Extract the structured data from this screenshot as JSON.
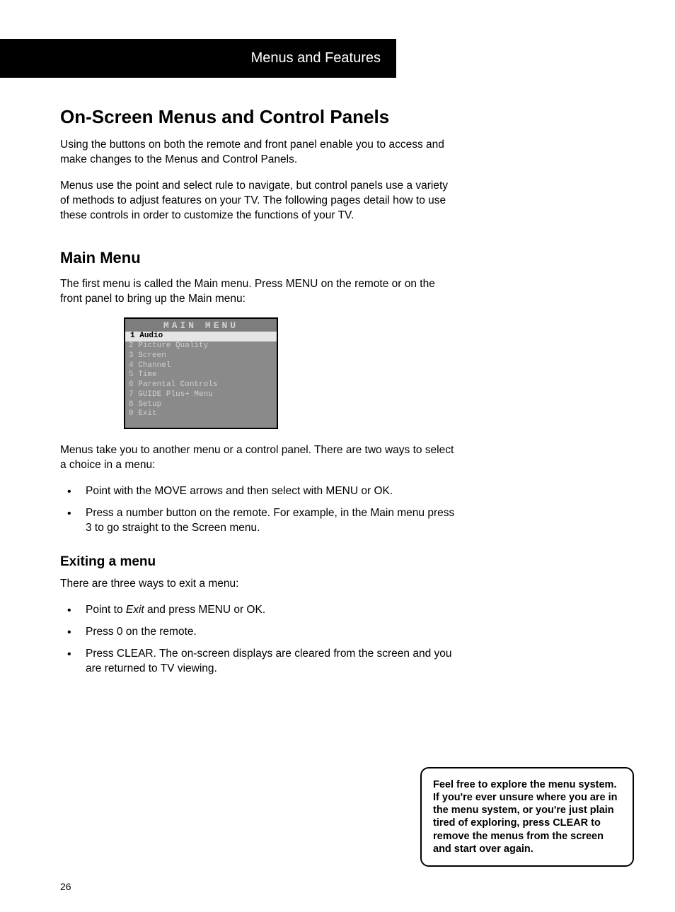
{
  "chapter_bar": "Menus and Features",
  "section1": {
    "title": "On-Screen Menus and Control Panels",
    "p1": "Using the buttons on both the remote and front panel enable you to access and make changes to the Menus and Control Panels.",
    "p2": "Menus use the point and select rule to navigate, but control panels use a variety of methods to adjust features on your TV. The following pages detail how to use these controls in order to customize the functions of your TV."
  },
  "section2": {
    "title": "Main Menu",
    "p1": "The first menu is called the Main menu. Press MENU on the remote or on the front panel to bring up the Main menu:",
    "osd_title": "MAIN MENU",
    "osd_items": [
      {
        "num": "1",
        "label": "Audio"
      },
      {
        "num": "2",
        "label": "Picture Quality"
      },
      {
        "num": "3",
        "label": "Screen"
      },
      {
        "num": "4",
        "label": "Channel"
      },
      {
        "num": "5",
        "label": "Time"
      },
      {
        "num": "6",
        "label": "Parental Controls"
      },
      {
        "num": "7",
        "label": "GUIDE Plus+ Menu"
      },
      {
        "num": "8",
        "label": "Setup"
      },
      {
        "num": "0",
        "label": "Exit"
      }
    ],
    "p2": "Menus take you to another menu or a control panel. There are two ways to select a choice in a menu:",
    "bullets": [
      "Point with the MOVE arrows and then select with MENU or OK.",
      "Press a number button on the remote. For example, in the Main menu press 3 to go straight to the Screen menu."
    ]
  },
  "section3": {
    "title": "Exiting a menu",
    "p1": "There are three ways to exit a menu:",
    "bullets_pre": "Point to ",
    "bullets_mid": "Exit",
    "bullets_post": " and press MENU or OK.",
    "b2": "Press 0 on the remote.",
    "b3": "Press CLEAR. The on-screen displays are cleared from the screen and you are returned to TV viewing."
  },
  "tip": "Feel free to explore the menu system. If you're ever unsure where you are in the menu system, or you're just plain tired of exploring, press CLEAR to remove the menus from the screen and start over again.",
  "page_number": "26"
}
